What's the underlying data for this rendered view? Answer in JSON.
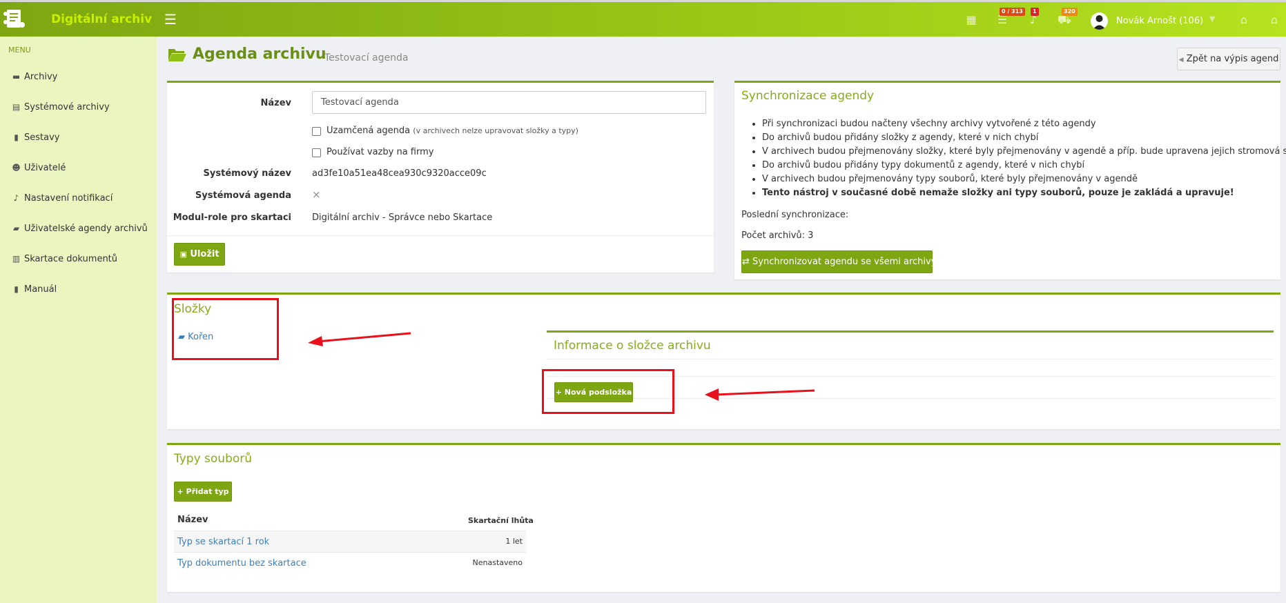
{
  "app": {
    "title": "Digitální archiv",
    "menu_icon": "hamburger-icon"
  },
  "topbar": {
    "tasks_badge": "0 / 313",
    "notifications_badge": "1",
    "messages_badge": "320",
    "user_name": "Novák Arnošt (106)"
  },
  "sidebar": {
    "menu_label": "MENU",
    "items": [
      {
        "label": "Archivy",
        "icon": "archive-box-icon"
      },
      {
        "label": "Systémové archivy",
        "icon": "server-icon"
      },
      {
        "label": "Sestavy",
        "icon": "book-icon"
      },
      {
        "label": "Uživatelé",
        "icon": "users-icon"
      },
      {
        "label": "Nastavení notifikací",
        "icon": "bell-icon"
      },
      {
        "label": "Uživatelské agendy archivů",
        "icon": "folder-open-icon"
      },
      {
        "label": "Skartace dokumentů",
        "icon": "trash-icon"
      },
      {
        "label": "Manuál",
        "icon": "book-icon"
      }
    ]
  },
  "page": {
    "title": "Agenda archivu",
    "subtitle": "Testovací agenda",
    "back_button": "Zpět na výpis agend"
  },
  "form": {
    "name_label": "Název",
    "name_value": "Testovací agenda",
    "locked_label": "Uzamčená agenda",
    "locked_note": "(v archivech nelze upravovat složky a typy)",
    "firms_label": "Používat vazby na firmy",
    "sys_name_label": "Systémový název",
    "sys_name_value": "ad3fe10a51ea48cea930c9320acce09c",
    "sys_agenda_label": "Systémová agenda",
    "sys_agenda_value": "×",
    "module_label": "Modul-role pro skartaci",
    "module_value": "Digitální archiv - Správce nebo Skartace",
    "save_button": "Uložit"
  },
  "sync": {
    "title": "Synchronizace agendy",
    "bullets": [
      "Při synchronizaci budou načteny všechny archivy vytvořené z této agendy",
      "Do archivů budou přidány složky z agendy, které v nich chybí",
      "V archivech budou přejmenovány složky, které byly přejmenovány v agendě a příp. bude upravena jejich stromová struktura",
      "Do archivů budou přidány typy dokumentů z agendy, které v nich chybí",
      "V archivech budou přejmenovány typy souborů, které byly přejmenovány v agendě"
    ],
    "bold_bullet": "Tento nástroj v současné době nemaže složky ani typy souborů, pouze je zakládá a upravuje!",
    "last_sync": "Poslední synchronizace:",
    "archive_count": "Počet archivů: 3",
    "sync_button": "Synchronizovat agendu se všemi archivy"
  },
  "folders": {
    "title": "Složky",
    "root": "Kořen",
    "info_title": "Informace o složce archivu",
    "new_subfolder": "Nová podsložka"
  },
  "types": {
    "title": "Typy souborů",
    "add_button": "Přidat typ",
    "col_name": "Název",
    "col_period": "Skartační lhůta",
    "rows": [
      {
        "name": "Typ se skartací 1 rok",
        "period": "1 let"
      },
      {
        "name": "Typ dokumentu bez skartace",
        "period": "Nenastaveno"
      }
    ]
  },
  "colors": {
    "brand": "#7ea612",
    "brand_light": "#b6e31e",
    "sidebar_bg": "#ebf5c0",
    "link": "#3e7fb7",
    "annotation": "#e8101a"
  }
}
